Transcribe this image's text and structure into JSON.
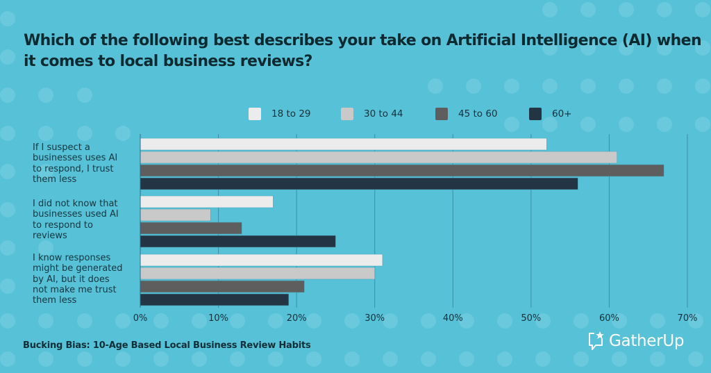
{
  "title": "Which of the following best describes your take on Artificial Intelligence (AI) when it comes to local business reviews?",
  "footer": "Bucking Bias: 10-Age Based Local Business Review Habits",
  "logo": {
    "text": "GatherUp",
    "icon": "speech-bubble-star-icon"
  },
  "colors": {
    "background": "#57c1d7",
    "dots": "#6ac9dd",
    "gridline": "#3b8fa3",
    "text": "#0d2a30"
  },
  "chart_data": {
    "type": "bar",
    "orientation": "horizontal",
    "title": "Which of the following best describes your take on Artificial Intelligence (AI) when it comes to local business reviews?",
    "xlabel": "",
    "ylabel": "",
    "xlim": [
      0,
      70
    ],
    "x_ticks": [
      0,
      10,
      20,
      30,
      40,
      50,
      60,
      70
    ],
    "x_tick_labels": [
      "0%",
      "10%",
      "20%",
      "30%",
      "40%",
      "50%",
      "60%",
      "70%"
    ],
    "grid": true,
    "legend_position": "top",
    "categories": [
      "If I suspect a businesses uses AI to respond, I trust them less",
      "I did not know that businesses used AI to respond to reviews",
      "I know responses might be generated by AI, but it does not make me trust them less"
    ],
    "category_label_lines": [
      [
        "If I suspect a",
        "businesses uses AI",
        "to respond, I trust",
        "them less"
      ],
      [
        "I did not know that",
        "businesses used AI",
        "to respond to",
        "reviews"
      ],
      [
        "I know responses",
        "might be generated",
        "by AI, but it does",
        "not make me trust",
        "them less"
      ]
    ],
    "series": [
      {
        "name": "18 to 29",
        "color": "#ececec",
        "values": [
          52,
          17,
          31
        ]
      },
      {
        "name": "30 to 44",
        "color": "#c9c9c9",
        "values": [
          61,
          9,
          30
        ]
      },
      {
        "name": "45 to 60",
        "color": "#5e5e5e",
        "values": [
          67,
          13,
          21
        ]
      },
      {
        "name": "60+",
        "color": "#233545",
        "values": [
          56,
          25,
          19
        ]
      }
    ],
    "unit": "%"
  }
}
